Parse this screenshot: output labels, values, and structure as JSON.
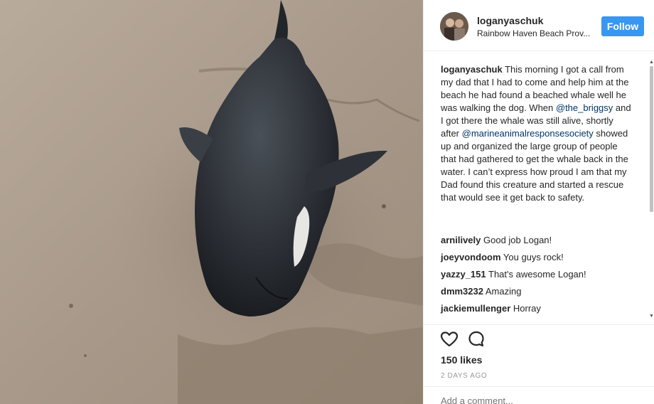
{
  "post": {
    "photo_alt": "photo-of-beached-whale",
    "author": {
      "username": "loganyaschuk",
      "location": "Rainbow Haven Beach Prov..."
    },
    "follow_label": "Follow",
    "caption": {
      "username": "loganyaschuk",
      "text_1": "This morning I got a call from my dad that I had to come and help him at the beach he had found a beached whale well he was walking the dog. When ",
      "mention_1": "@the_briggsy",
      "text_2": " and I got there the whale was still alive, shortly after ",
      "mention_2": "@marineanimalresponsesociety",
      "text_3": " showed up and organized the large group of people that had gathered to get the whale back in the water. I can’t express how proud I am that my Dad found this creature and started a rescue that would see it get back to safety."
    },
    "comments": [
      {
        "username": "arnilively",
        "text": "Good job Logan!"
      },
      {
        "username": "joeyvondoom",
        "text": "You guys rock!"
      },
      {
        "username": "yazzy_151",
        "text": "That's awesome Logan!"
      },
      {
        "username": "dmm3232",
        "text": "Amazing"
      },
      {
        "username": "jackiemullenger",
        "text": "Horray"
      }
    ],
    "likes": "150 likes",
    "timestamp": "2 DAYS AGO",
    "add_comment_placeholder": "Add a comment..."
  },
  "icons": {
    "like": "heart-outline-icon",
    "comment": "speech-bubble-icon",
    "scroll_up": "triangle-up",
    "scroll_down": "triangle-down"
  },
  "colors": {
    "follow_button": "#3897f0",
    "mention": "#003569",
    "text": "#262626",
    "muted": "#999999"
  }
}
